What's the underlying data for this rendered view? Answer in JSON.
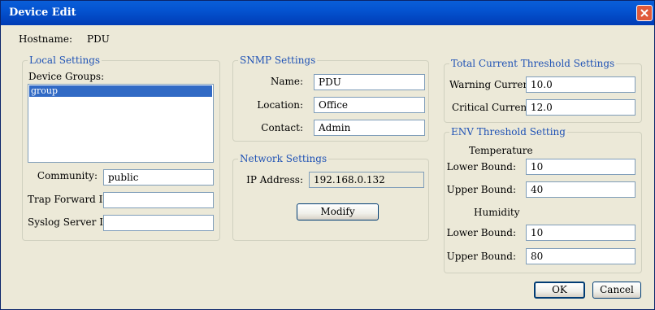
{
  "window": {
    "title": "Device Edit"
  },
  "hostname": {
    "label": "Hostname:",
    "value": "PDU"
  },
  "local_settings": {
    "legend": "Local Settings",
    "device_groups_label": "Device Groups:",
    "device_groups": [
      "group"
    ],
    "community_label": "Community:",
    "community_value": "public",
    "trap_forward_label": "Trap Forward IP:",
    "trap_forward_value": "",
    "syslog_label": "Syslog Server IP:",
    "syslog_value": ""
  },
  "snmp_settings": {
    "legend": "SNMP Settings",
    "name_label": "Name:",
    "name_value": "PDU",
    "location_label": "Location:",
    "location_value": "Office",
    "contact_label": "Contact:",
    "contact_value": "Admin"
  },
  "network_settings": {
    "legend": "Network Settings",
    "ip_label": "IP Address:",
    "ip_value": "192.168.0.132",
    "modify_label": "Modify"
  },
  "total_current": {
    "legend": "Total Current Threshold Settings",
    "warning_label": "Warning Current:",
    "warning_value": "10.0",
    "critical_label": "Critical Current:",
    "critical_value": "12.0"
  },
  "env_threshold": {
    "legend": "ENV Threshold Setting",
    "temperature_label": "Temperature",
    "temp_lower_label": "Lower Bound:",
    "temp_lower_value": "10",
    "temp_upper_label": "Upper Bound:",
    "temp_upper_value": "40",
    "humidity_label": "Humidity",
    "hum_lower_label": "Lower Bound:",
    "hum_lower_value": "10",
    "hum_upper_label": "Upper Bound:",
    "hum_upper_value": "80"
  },
  "buttons": {
    "ok_label": "OK",
    "cancel_label": "Cancel"
  },
  "icons": {
    "close": "close-icon"
  },
  "colors": {
    "titlebar": "#0453d0",
    "legend_text": "#1f52b5",
    "dialog_bg": "#ece9d8",
    "selection": "#316ac5"
  }
}
